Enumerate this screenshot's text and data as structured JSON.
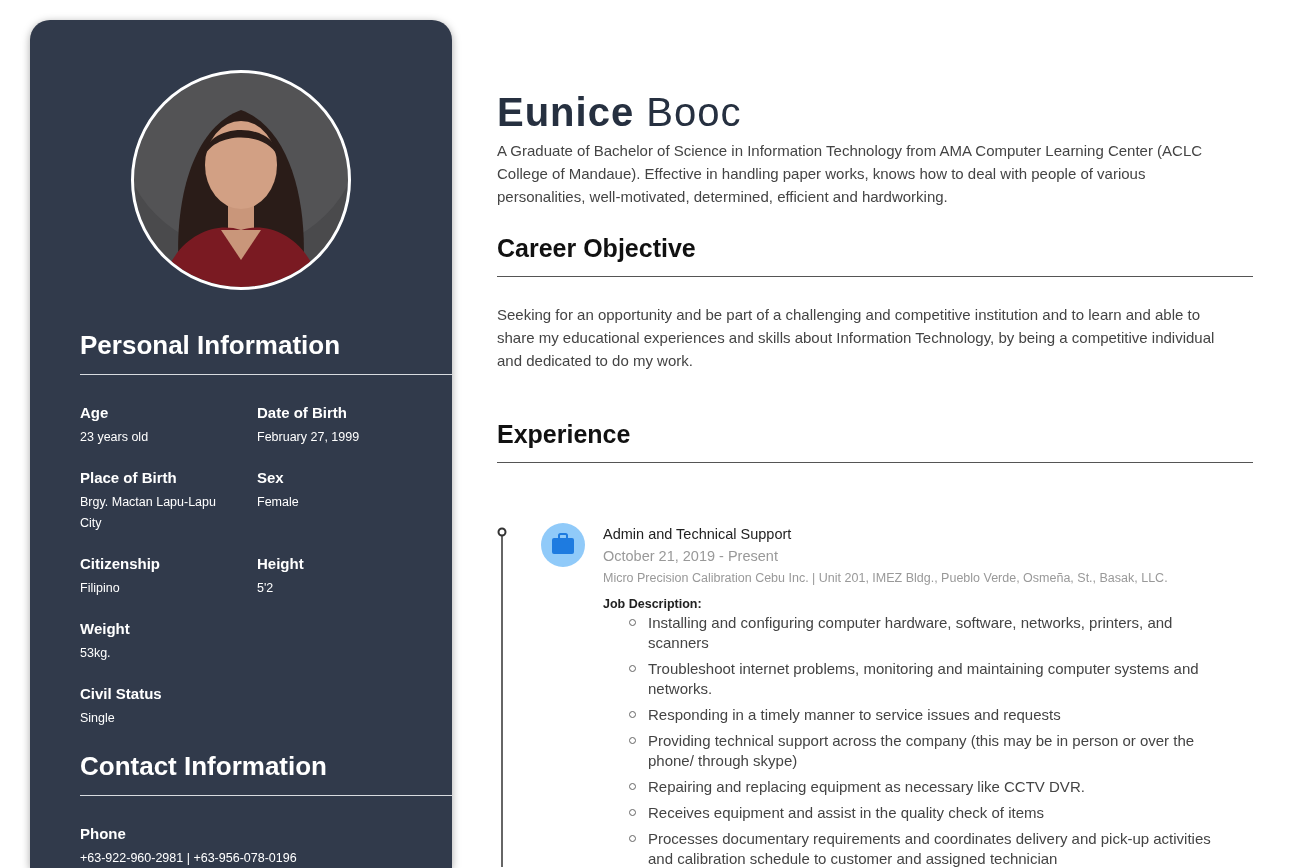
{
  "profile": {
    "first_name": "Eunice",
    "last_name": "Booc",
    "summary": "A Graduate of Bachelor of Science in Information Technology from AMA Computer Learning Center (ACLC College of Mandaue). Effective in handling paper works, knows how to deal with people of various personalities, well-motivated, determined, efficient and hardworking."
  },
  "sidebar": {
    "sections": [
      {
        "title": "Personal Information",
        "rows": [
          [
            {
              "label": "Age",
              "value": "23 years old"
            },
            {
              "label": "Date of Birth",
              "value": "February 27, 1999"
            }
          ],
          [
            {
              "label": "Place of Birth",
              "value": "Brgy. Mactan Lapu-Lapu City"
            },
            {
              "label": "Sex",
              "value": "Female"
            }
          ],
          [
            {
              "label": "Citizenship",
              "value": "Filipino"
            },
            {
              "label": "Height",
              "value": "5'2"
            }
          ],
          [
            {
              "label": "Weight",
              "value": "53kg."
            }
          ],
          [
            {
              "label": "Civil Status",
              "value": "Single"
            }
          ]
        ]
      },
      {
        "title": "Contact Information",
        "rows": [
          [
            {
              "label": "Phone",
              "value": "+63-922-960-2981 | +63-956-078-0196"
            }
          ]
        ]
      }
    ]
  },
  "career_objective": {
    "title": "Career Objective",
    "text": "Seeking for an opportunity and be part of a challenging and competitive institution and to learn and able to share my educational experiences and skills about Information Technology, by being a competitive individual and dedicated to do my work."
  },
  "experience": {
    "title": "Experience",
    "items": [
      {
        "position": "Admin and Technical Support",
        "dates": "October 21, 2019 - Present",
        "company": "Micro Precision Calibration Cebu Inc. | Unit 201, IMEZ Bldg., Pueblo Verde, Osmeña, St., Basak, LLC.",
        "description_label": "Job Description:",
        "duties": [
          "Installing and configuring computer hardware, software, networks, printers, and scanners",
          "Troubleshoot internet problems, monitoring and maintaining computer systems and networks.",
          "Responding in a timely manner to service issues and requests",
          "Providing technical support across the company (this may be in person or over the phone/ through skype)",
          "Repairing and replacing equipment as necessary like CCTV DVR.",
          "Receives equipment and assist in the quality check of items",
          "Processes documentary requirements and coordinates delivery and pick-up activities and calibration schedule to customer and assigned technician"
        ]
      }
    ]
  }
}
